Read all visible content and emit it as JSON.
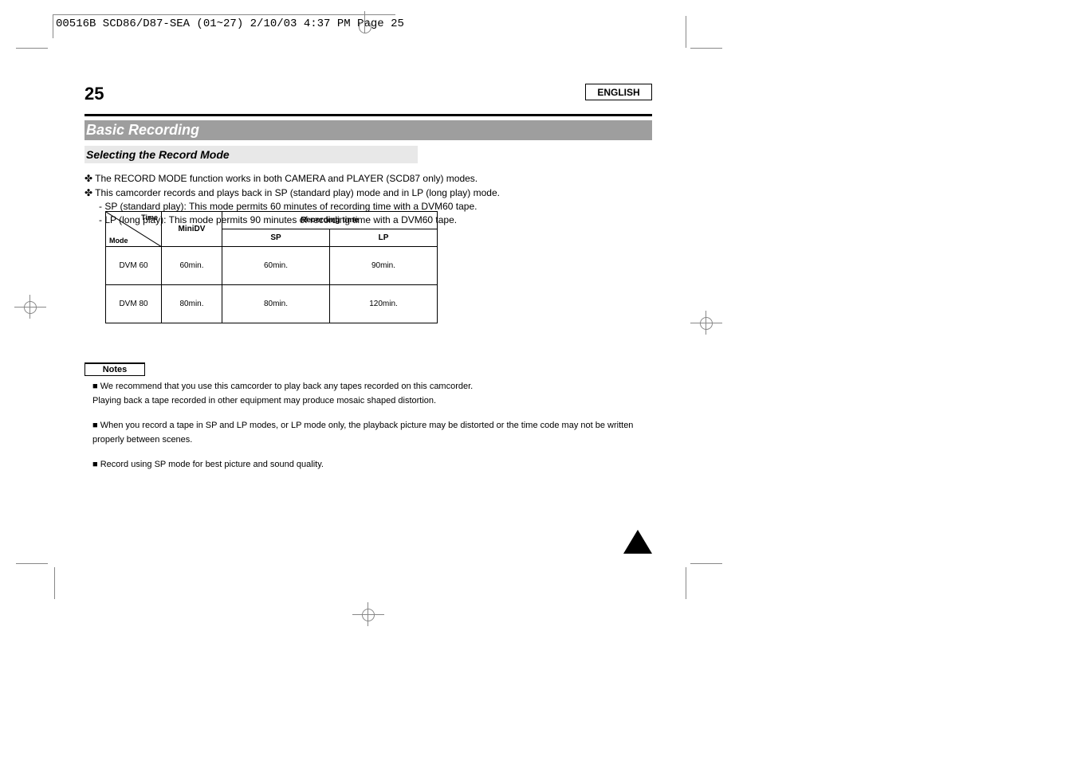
{
  "header": {
    "info": "00516B SCD86/D87-SEA (01~27)  2/10/03 4:37 PM  Page 25"
  },
  "page": {
    "language": "ENGLISH",
    "number": "25",
    "title_main": "Basic Recording",
    "title_sub": "Selecting the Record Mode",
    "line1": "✤ The RECORD MODE function works in both CAMERA and PLAYER (SCD87 only) modes.",
    "line2": "✤ This camcorder records and plays back in SP (standard play) mode and in LP (long play) mode.",
    "line2_sp": "SP (standard play): This mode permits 60 minutes of recording time with a DVM60 tape.",
    "line2_lp": "LP (long play): This mode permits 90 minutes of recording time with a DVM60 tape.",
    "notes_label": "Notes",
    "notes": {
      "n1": "■  We recommend that you use this camcorder to play back any tapes recorded on this camcorder.",
      "n1b": "Playing back a tape recorded in other equipment may produce mosaic shaped distortion.",
      "n2": "■  When you record a tape in SP and LP modes, or LP mode only, the playback picture may be distorted or the time code may not be written properly between scenes.",
      "n3": "■  Record using SP mode for best picture and sound quality."
    }
  },
  "table": {
    "col_time": "Time",
    "col_mode": "Mode",
    "col_minidv": "MiniDV",
    "col_rec_header": "Recording time",
    "col_sp": "SP",
    "col_lp": "LP",
    "dvm60_label": "DVM 60",
    "dvm60_min": "60min.",
    "dvm60_sp": "60min.",
    "dvm60_lp": "90min.",
    "dvm80_label": "DVM 80",
    "dvm80_min": "80min.",
    "dvm80_sp": "80min.",
    "dvm80_lp": "120min."
  }
}
